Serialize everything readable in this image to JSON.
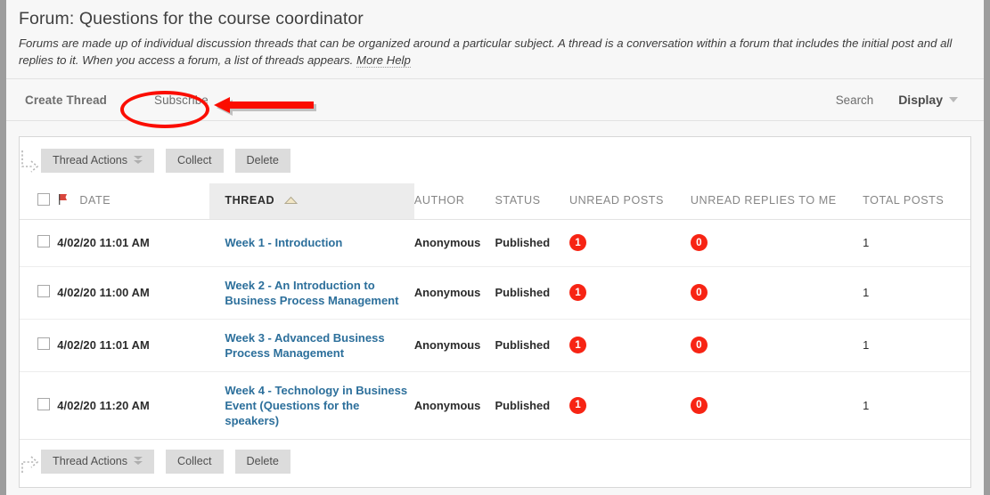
{
  "header": {
    "title": "Forum: Questions for the course coordinator",
    "description": "Forums are made up of individual discussion threads that can be organized around a particular subject. A thread is a conversation within a forum that includes the initial post and all replies to it. When you access a forum, a list of threads appears.",
    "more_help_label": "More Help"
  },
  "action_bar": {
    "create_thread_label": "Create Thread",
    "subscribe_label": "Subscribe",
    "search_label": "Search",
    "display_label": "Display",
    "display_caret_icon": "chevron-down-icon"
  },
  "toolbar": {
    "thread_actions_label": "Thread Actions",
    "thread_actions_caret_icon": "double-chevron-down-icon",
    "collect_label": "Collect",
    "delete_label": "Delete",
    "flow_arrow_icon": "dotted-arrow-icon"
  },
  "table": {
    "select_all_icon": "checkbox-unchecked-icon",
    "flag_icon": "red-flag-icon",
    "sort_ascending_icon": "triangle-up-icon",
    "columns": [
      {
        "key": "date",
        "label": "DATE",
        "sorted": false
      },
      {
        "key": "thread",
        "label": "THREAD",
        "sorted": true
      },
      {
        "key": "author",
        "label": "AUTHOR",
        "sorted": false
      },
      {
        "key": "status",
        "label": "STATUS",
        "sorted": false
      },
      {
        "key": "unread",
        "label": "UNREAD POSTS",
        "sorted": false
      },
      {
        "key": "repl",
        "label": "UNREAD REPLIES TO ME",
        "sorted": false
      },
      {
        "key": "total",
        "label": "TOTAL POSTS",
        "sorted": false
      }
    ],
    "rows": [
      {
        "date": "4/02/20 11:01 AM",
        "thread": "Week 1 - Introduction",
        "author": "Anonymous",
        "status": "Published",
        "unread_posts": "1",
        "unread_replies_to_me": "0",
        "total_posts": "1"
      },
      {
        "date": "4/02/20 11:00 AM",
        "thread": "Week 2 - An Introduction to Business Process Management",
        "author": "Anonymous",
        "status": "Published",
        "unread_posts": "1",
        "unread_replies_to_me": "0",
        "total_posts": "1"
      },
      {
        "date": "4/02/20 11:01 AM",
        "thread": "Week 3 - Advanced Business Process Management",
        "author": "Anonymous",
        "status": "Published",
        "unread_posts": "1",
        "unread_replies_to_me": "0",
        "total_posts": "1"
      },
      {
        "date": "4/02/20 11:20 AM",
        "thread": "Week 4 - Technology in Business Event (Questions for the speakers)",
        "author": "Anonymous",
        "status": "Published",
        "unread_posts": "1",
        "unread_replies_to_me": "0",
        "total_posts": "1"
      }
    ]
  },
  "annotations": {
    "highlight_target": "Subscribe",
    "highlight_shape": "ellipse",
    "pointer_shape": "left-arrow",
    "color": "#fb0d00"
  },
  "colors": {
    "badge_red": "#f72414",
    "link_blue": "#2c6f9b",
    "page_bg": "#f7f7f7",
    "annotation_red": "#fb0d00"
  }
}
